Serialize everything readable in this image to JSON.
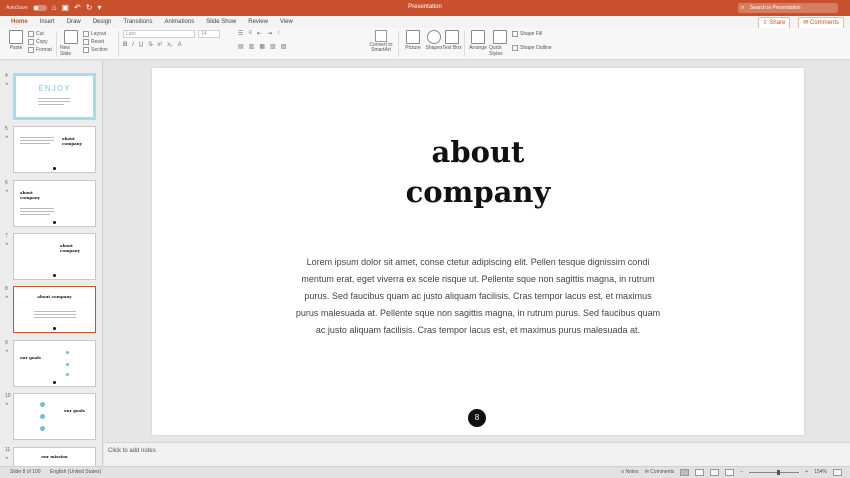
{
  "titlebar": {
    "autosave_label": "AutoSave",
    "autosave_state": "OFF",
    "window_title": "Presentation",
    "search_placeholder": "Search in Presentation"
  },
  "tabs": [
    "Home",
    "Insert",
    "Draw",
    "Design",
    "Transitions",
    "Animations",
    "Slide Show",
    "Review",
    "View"
  ],
  "active_tab": "Home",
  "tab_actions": {
    "share": "Share",
    "comments": "Comments"
  },
  "ribbon": {
    "paste": "Paste",
    "cut": "Cut",
    "copy": "Copy",
    "format": "Format",
    "new_slide": "New Slide",
    "layout": "Layout",
    "reset": "Reset",
    "section": "Section",
    "font_name": "Lato",
    "font_size": "14",
    "convert_smartart": "Convert to SmartArt",
    "picture": "Picture",
    "shapes": "Shapes",
    "text_box": "Text Box",
    "arrange": "Arrange",
    "quick_styles": "Quick Styles",
    "shape_fill": "Shape Fill",
    "shape_outline": "Shape Outline"
  },
  "thumbnails": [
    {
      "num": "4",
      "title": "ENJOY"
    },
    {
      "num": "5",
      "title": "about company"
    },
    {
      "num": "6",
      "title": "about company"
    },
    {
      "num": "7",
      "title": "about company"
    },
    {
      "num": "8",
      "title": "about company"
    },
    {
      "num": "9",
      "title": "our goals"
    },
    {
      "num": "10",
      "title": "our goals"
    },
    {
      "num": "11",
      "title": "our mission"
    }
  ],
  "slide": {
    "title_line1": "about",
    "title_line2": "company",
    "body": "Lorem ipsum dolor sit amet, conse ctetur adipiscing elit. Pellen tesque dignissim condi mentum erat, eget viverra ex scele risque ut. Pellente sque non sagittis magna, in rutrum purus. Sed faucibus quam ac justo aliquam facilisis. Cras tempor lacus est, et maximus purus malesuada at. Pellente sque non sagittis magna, in rutrum purus. Sed faucibus quam ac justo aliquam facilisis. Cras tempor lacus est, et maximus purus malesuada at.",
    "page_number": "8"
  },
  "notes_placeholder": "Click to add notes",
  "status": {
    "slide_info": "Slide 8 of 100",
    "language": "English (United States)",
    "notes": "Notes",
    "comments": "Comments",
    "zoom": "154%"
  }
}
